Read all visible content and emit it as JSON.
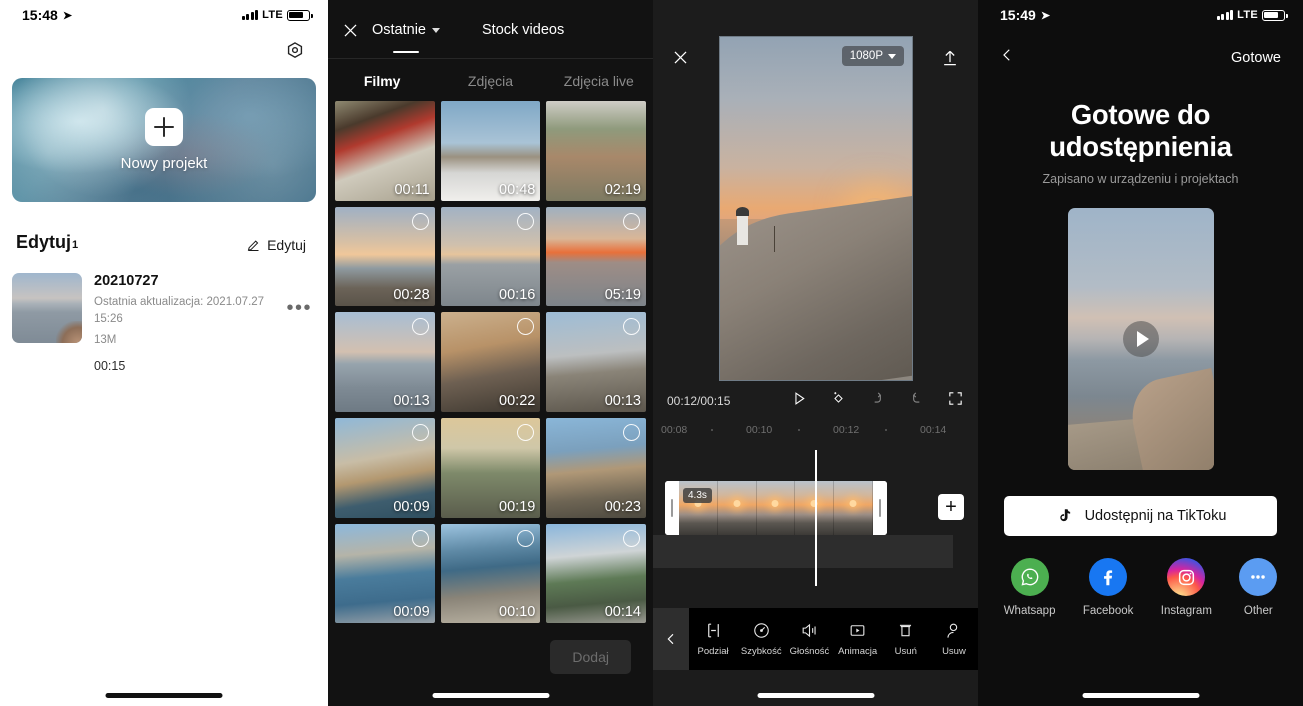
{
  "panel1": {
    "status": {
      "time": "15:48",
      "carrier": "LTE"
    },
    "settings_icon": "gear-icon",
    "hero": {
      "label": "Nowy projekt"
    },
    "section": {
      "title": "Edytuj",
      "count": "1",
      "edit_label": "Edytuj"
    },
    "project": {
      "name": "20210727",
      "updated": "Ostatnia aktualizacja: 2021.07.27 15:26",
      "size": "13M",
      "duration": "00:15",
      "more": "•••"
    }
  },
  "panel2": {
    "close_icon": "close-icon",
    "top_tabs": [
      {
        "label": "Ostatnie",
        "active": true,
        "has_caret": true
      },
      {
        "label": "Stock videos",
        "active": false,
        "has_caret": false
      }
    ],
    "sub_tabs": [
      {
        "label": "Filmy",
        "active": true
      },
      {
        "label": "Zdjęcia",
        "active": false
      },
      {
        "label": "Zdjęcia live",
        "active": false
      }
    ],
    "media": [
      {
        "duration": "00:11",
        "selectable": false
      },
      {
        "duration": "00:48",
        "selectable": false
      },
      {
        "duration": "02:19",
        "selectable": false
      },
      {
        "duration": "00:28",
        "selectable": true
      },
      {
        "duration": "00:16",
        "selectable": true
      },
      {
        "duration": "05:19",
        "selectable": true
      },
      {
        "duration": "00:13",
        "selectable": true
      },
      {
        "duration": "00:22",
        "selectable": true
      },
      {
        "duration": "00:13",
        "selectable": true
      },
      {
        "duration": "00:09",
        "selectable": true
      },
      {
        "duration": "00:19",
        "selectable": true
      },
      {
        "duration": "00:23",
        "selectable": true
      },
      {
        "duration": "00:09",
        "selectable": true
      },
      {
        "duration": "00:10",
        "selectable": true
      },
      {
        "duration": "00:14",
        "selectable": true
      }
    ],
    "add_button": "Dodaj"
  },
  "panel3": {
    "close_icon": "close-icon",
    "export_icon": "upload-icon",
    "resolution": "1080P",
    "timecode": "00:12/00:15",
    "player_icons": [
      "play-icon",
      "magic-wand-icon",
      "undo-icon",
      "redo-icon",
      "fullscreen-icon"
    ],
    "ruler_ticks": [
      "00:08",
      "00:10",
      "00:12",
      "00:14"
    ],
    "clip_badge": "4.3s",
    "add_track_icon": "plus-icon",
    "toolbar": {
      "back_icon": "chevron-left-icon",
      "items": [
        {
          "label": "Podział",
          "icon": "split-icon"
        },
        {
          "label": "Szybkość",
          "icon": "speed-icon"
        },
        {
          "label": "Głośność",
          "icon": "volume-icon"
        },
        {
          "label": "Animacja",
          "icon": "animation-icon"
        },
        {
          "label": "Usuń",
          "icon": "trash-icon"
        },
        {
          "label": "Usuw",
          "icon": "person-cutout-icon"
        }
      ]
    }
  },
  "panel4": {
    "status": {
      "time": "15:49",
      "carrier": "LTE"
    },
    "back_icon": "chevron-left-icon",
    "done_label": "Gotowe",
    "title": "Gotowe do udostępnienia",
    "subtitle": "Zapisano w urządzeniu i projektach",
    "play_icon": "play-icon",
    "tiktok_button": {
      "label": "Udostępnij na TikToku",
      "icon": "tiktok-icon"
    },
    "share_targets": [
      {
        "label": "Whatsapp",
        "icon": "whatsapp-icon",
        "color": "#4caf50"
      },
      {
        "label": "Facebook",
        "icon": "facebook-icon",
        "color": "#1877f2"
      },
      {
        "label": "Instagram",
        "icon": "instagram-icon",
        "color": "#d6249f"
      },
      {
        "label": "Other",
        "icon": "more-icon",
        "color": "#5b9cf2"
      }
    ]
  }
}
